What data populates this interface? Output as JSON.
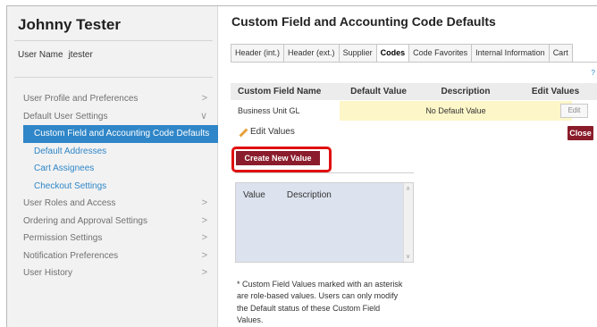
{
  "sidebar": {
    "user_title": "Johnny Tester",
    "user_label": "User Name",
    "user_value": "jtester",
    "items": [
      {
        "label": "User Profile and Preferences",
        "chevron": ">"
      },
      {
        "label": "Default User Settings",
        "chevron": "∨"
      },
      {
        "label": "Custom Field and Accounting Code Defaults",
        "sub": true,
        "active": true
      },
      {
        "label": "Default Addresses",
        "sub": true
      },
      {
        "label": "Cart Assignees",
        "sub": true
      },
      {
        "label": "Checkout Settings",
        "sub": true
      },
      {
        "label": "User Roles and Access",
        "chevron": ">"
      },
      {
        "label": "Ordering and Approval Settings",
        "chevron": ">"
      },
      {
        "label": "Permission Settings",
        "chevron": ">"
      },
      {
        "label": "Notification Preferences",
        "chevron": ">"
      },
      {
        "label": "User History",
        "chevron": ">"
      }
    ]
  },
  "main": {
    "title": "Custom Field and Accounting Code Defaults",
    "tabs": [
      {
        "label": "Header (int.)"
      },
      {
        "label": "Header (ext.)"
      },
      {
        "label": "Supplier"
      },
      {
        "label": "Codes",
        "active": true
      },
      {
        "label": "Code Favorites"
      },
      {
        "label": "Internal Information"
      },
      {
        "label": "Cart"
      }
    ],
    "help_mark": "?",
    "table": {
      "headers": [
        "Custom Field Name",
        "Default Value",
        "Description",
        "Edit Values"
      ],
      "row": {
        "name": "Business Unit GL",
        "default_value": "No Default Value",
        "edit_label": "Edit"
      }
    },
    "edit_values_label": "Edit Values",
    "close_label": "Close",
    "create_new_label": "Create New Value",
    "list_headers": [
      "Value",
      "Description"
    ],
    "note": "* Custom Field Values marked with an asterisk are role-based values. Users can only modify the Default status of these Custom Field Values."
  },
  "colors": {
    "accent_blue": "#2f86c8",
    "button_maroon": "#8a1c2b",
    "highlight_red": "#e01010",
    "default_value_bg": "#fdf6c8"
  }
}
